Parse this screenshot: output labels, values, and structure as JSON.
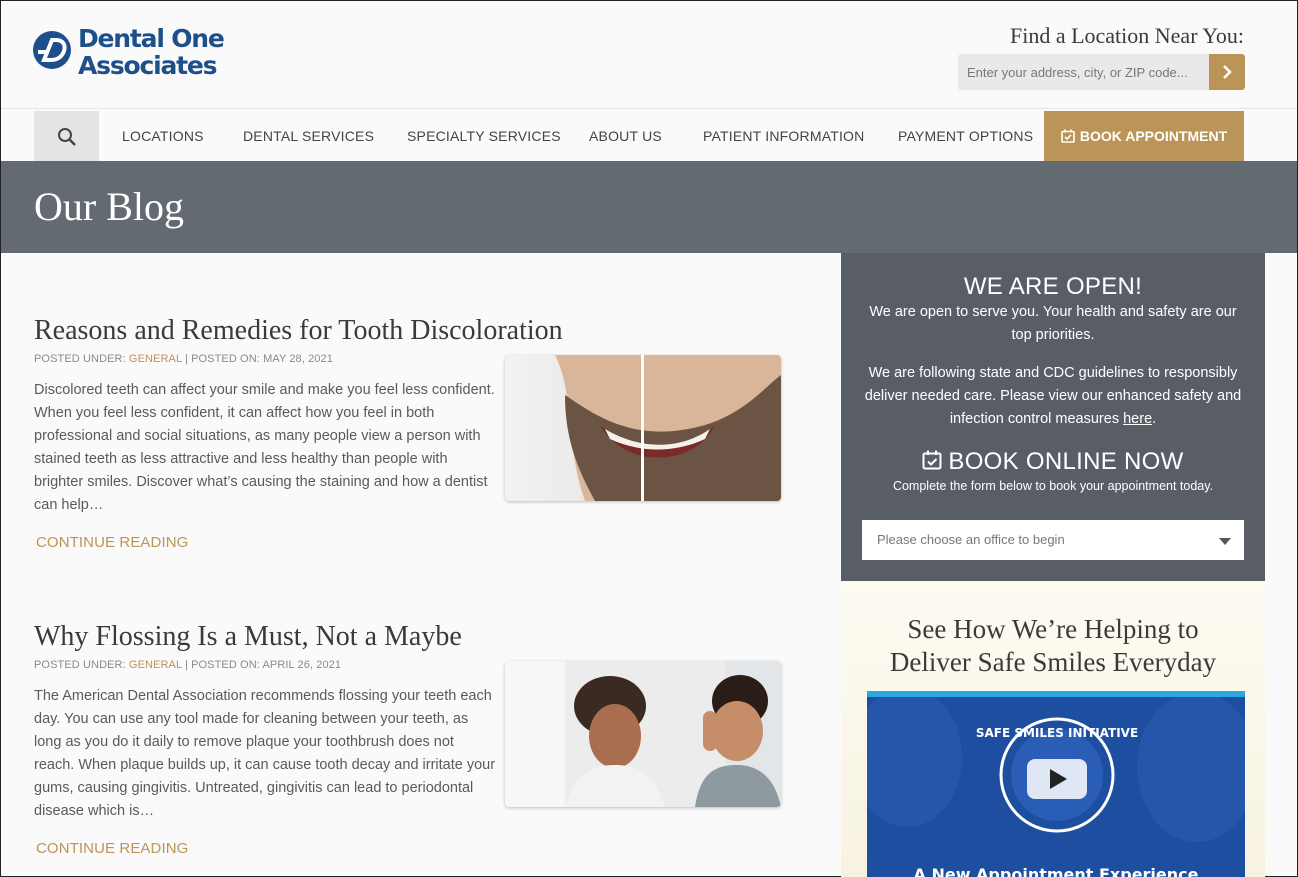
{
  "header": {
    "logo_line1": "Dental One",
    "logo_line2": "Associates",
    "find_title": "Find a Location Near You:",
    "location_placeholder": "Enter your address, city, or ZIP code..."
  },
  "nav": {
    "items": [
      "LOCATIONS",
      "DENTAL SERVICES",
      "SPECIALTY SERVICES",
      "ABOUT US",
      "PATIENT INFORMATION",
      "PAYMENT OPTIONS"
    ],
    "book_label": "BOOK APPOINTMENT"
  },
  "banner": {
    "title": "Our Blog"
  },
  "posts": [
    {
      "title": "Reasons and Remedies for Tooth Discoloration",
      "meta_prefix": "POSTED UNDER: ",
      "category": "GENERAL",
      "meta_suffix": " | POSTED ON: MAY 28, 2021",
      "excerpt": "Discolored teeth can affect your smile and make you feel less confident. When you feel less confident, it can affect how you feel in both professional and social situations, as many people view a person with stained teeth as less attractive and less healthy than people with brighter smiles. Discover what’s causing the staining and how a dentist can help…",
      "continue": "CONTINUE READING"
    },
    {
      "title": "Why Flossing Is a Must, Not a Maybe",
      "meta_prefix": "POSTED UNDER: ",
      "category": "GENERAL",
      "meta_suffix": " | POSTED ON: APRIL 26, 2021",
      "excerpt": "The American Dental Association recommends flossing your teeth each day. You can use any tool made for cleaning between your teeth, as long as you do it daily to remove plaque your toothbrush does not reach. When plaque builds up, it can cause tooth decay and irritate your gums, causing gingivitis. Untreated, gingivitis can lead to periodontal disease which is…",
      "continue": "CONTINUE READING"
    }
  ],
  "sidebar": {
    "open_title": "WE ARE OPEN!",
    "open_text": "We are open to serve you. Your health and safety are our top priorities.",
    "guidelines_text": "We are following state and CDC guidelines to responsibly deliver needed care. Please view our enhanced safety and infection control measures ",
    "here_link": "here",
    "period": ".",
    "book_title": "BOOK ONLINE NOW",
    "book_sub": "Complete the form below to book your appointment today.",
    "office_select": "Please choose an office to begin"
  },
  "safe": {
    "title_line1": "See How We’re Helping to",
    "title_line2": "Deliver Safe Smiles Everyday",
    "badge_text": "SAFE SMILES INITIATIVE",
    "video_caption": "A New Appointment Experience"
  },
  "colors": {
    "brand_blue": "#1d4f8b",
    "accent_gold": "#bb9457",
    "banner_gray": "#646a72",
    "sidebar_gray": "#595e66"
  }
}
